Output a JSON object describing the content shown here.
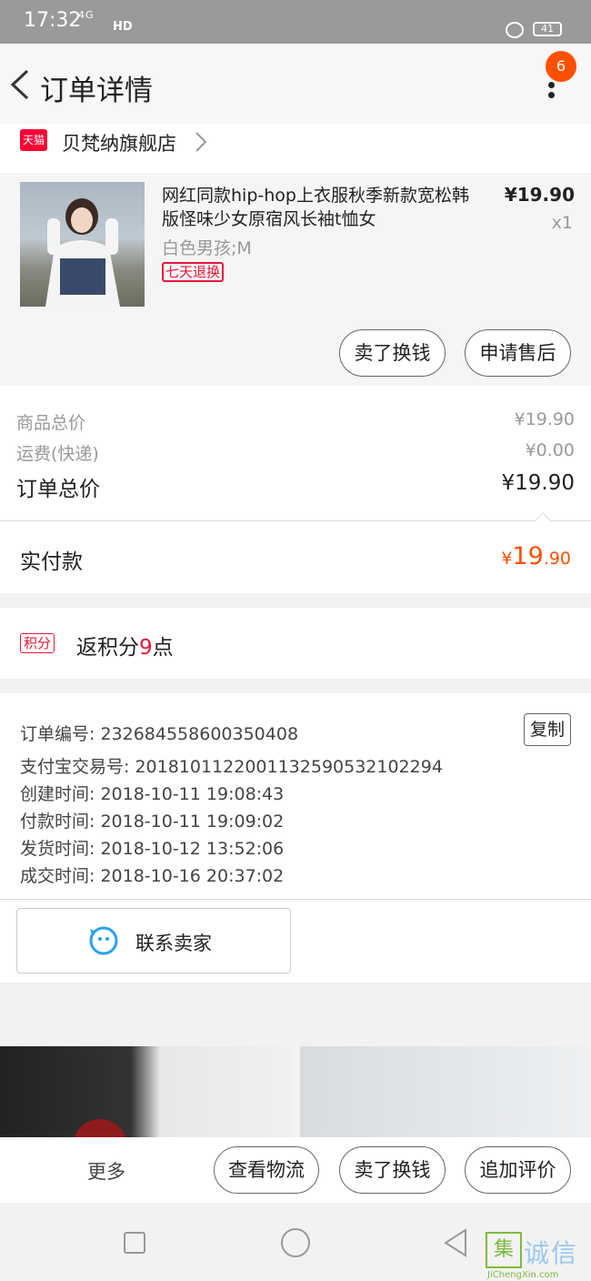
{
  "status_bar": {
    "time": "17:32",
    "network": "4G",
    "hd": "HD",
    "battery": "41"
  },
  "header": {
    "title": "订单详情",
    "badge_count": "6"
  },
  "store": {
    "tmall_badge": "天猫",
    "name": "贝梵纳旗舰店"
  },
  "product": {
    "name": "网红同款hip-hop上衣服秋季新款宽松韩版怪味少女原宿风长袖t恤女",
    "sku": "白色男孩;M",
    "tag": "七天退换",
    "price": "¥19.90",
    "quantity": "x1",
    "actions": {
      "sell": "卖了换钱",
      "after_sale": "申请售后"
    }
  },
  "summary": {
    "goods_label": "商品总价",
    "goods_value": "¥19.90",
    "shipping_label": "运费(快递)",
    "shipping_value": "¥0.00",
    "total_label": "订单总价",
    "total_value": "¥19.90",
    "paid_label": "实付款",
    "paid_currency": "¥",
    "paid_int": "19",
    "paid_dec": ".90"
  },
  "points": {
    "tag": "积分",
    "text_prefix": "返积分",
    "count": "9",
    "text_suffix": "点"
  },
  "order_info": {
    "order_no": "订单编号: 2326845586003504​08",
    "alipay_no": "支付宝交易号: 2018101122001132590532102294",
    "created": "创建时间: 2018-10-11 19:08:43",
    "paid": "付款时间: 2018-10-11 19:09:02",
    "shipped": "发货时间: 2018-10-12 13:52:06",
    "completed": "成交时间: 2018-10-16 20:37:02",
    "copy_label": "复制",
    "contact_label": "联系卖家"
  },
  "bottom_bar": {
    "more": "更多",
    "logistics": "查看物流",
    "sell": "卖了换钱",
    "review": "追加评价"
  },
  "watermark": {
    "logo": "集",
    "text": "诚信",
    "sub": "JiChengXin.com"
  },
  "colors": {
    "accent": "#ff5000",
    "tmall_red": "#ff0036",
    "tag_red": "#e6193a"
  }
}
